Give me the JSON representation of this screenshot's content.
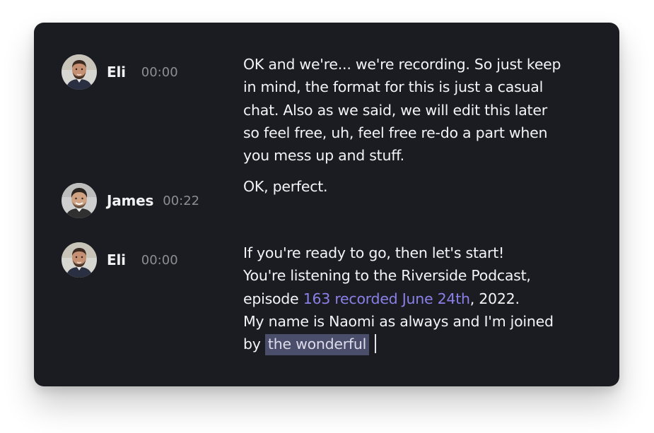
{
  "transcript": {
    "entries": [
      {
        "speaker": "Eli",
        "time": "00:00",
        "avatar_icon": "person-avatar-eli",
        "lines": [
          "OK and we're... we're recording. So just keep",
          "in mind, the format for this is just a casual",
          "chat. Also as we said, we will edit this later",
          "so feel free, uh, feel free re-do a part when",
          "you mess up and stuff."
        ]
      },
      {
        "speaker": "James",
        "time": "00:22",
        "avatar_icon": "person-avatar-james",
        "lines": [
          "OK, perfect."
        ]
      },
      {
        "speaker": "Eli",
        "time": "00:00",
        "avatar_icon": "person-avatar-eli",
        "line1": "If you're ready to go, then let's start!",
        "line2": "You're listening to the Riverside Podcast,",
        "line3_prefix": "episode ",
        "line3_link": "163 recorded June 24th",
        "line3_suffix": ", 2022.",
        "line4": "My name is Naomi as always and I'm joined",
        "line5_prefix": "by ",
        "line5_highlight": "the wonderful"
      }
    ]
  },
  "colors": {
    "card_background": "#1b1c21",
    "link": "#8a80e8",
    "highlight": "#4b4e6a",
    "timestamp": "#8c8e96"
  }
}
